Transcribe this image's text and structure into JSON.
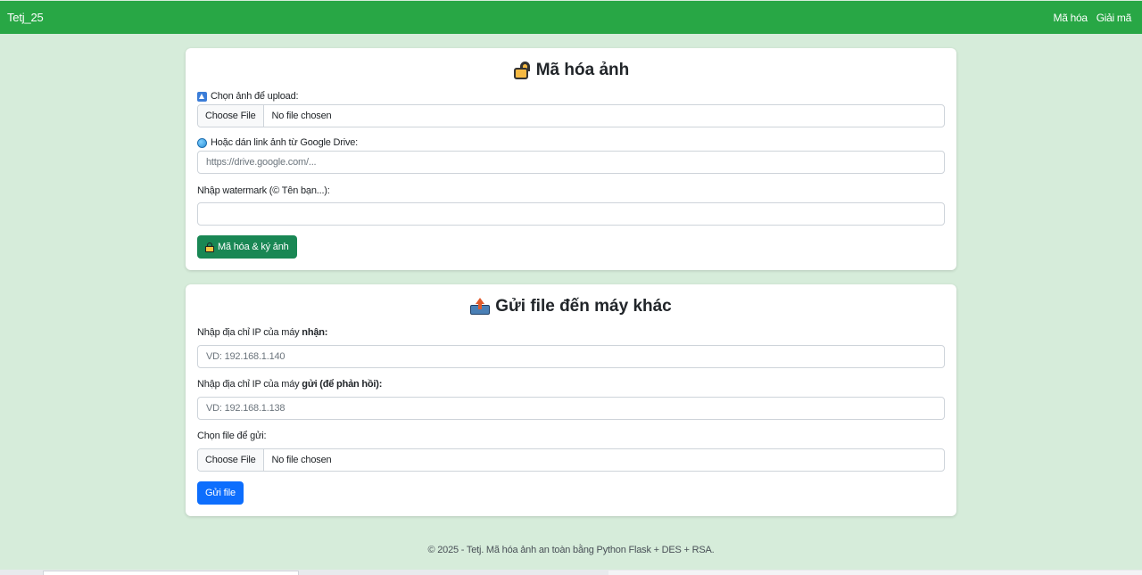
{
  "navbar": {
    "brand": "Tetj_25",
    "links": [
      "Mã hóa",
      "Giải mã"
    ],
    "color": "#28a745"
  },
  "encrypt_card": {
    "title": "Mã hóa ảnh",
    "title_icon": "lock-icon",
    "upload_label": "Chọn ảnh để upload:",
    "upload_icon": "upload-icon",
    "upload_button": "Choose File",
    "upload_status": "No file chosen",
    "drive_label": "Hoặc dán link ảnh từ Google Drive:",
    "drive_icon": "globe-icon",
    "drive_placeholder": "https://drive.google.com/...",
    "watermark_label": "Nhập watermark (© Tên bạn...):",
    "watermark_value": "",
    "submit_label": "Mã hóa & ký ảnh",
    "submit_color": "#198754"
  },
  "send_card": {
    "title": "Gửi file đến máy khác",
    "title_icon": "outbox-icon",
    "receiver_label_prefix": "Nhập địa chỉ IP của máy ",
    "receiver_label_bold": "nhận:",
    "receiver_placeholder": "VD: 192.168.1.140",
    "sender_label_prefix": "Nhập địa chỉ IP của máy ",
    "sender_label_bold": "gửi (để phản hồi):",
    "sender_placeholder": "VD: 192.168.1.138",
    "file_label": "Chọn file để gửi:",
    "file_button": "Choose File",
    "file_status": "No file chosen",
    "submit_label": "Gửi file",
    "submit_color": "#0d6efd"
  },
  "footer": {
    "text": "© 2025 - Tetj. Mã hóa ảnh an toàn bằng Python Flask + DES + RSA."
  }
}
